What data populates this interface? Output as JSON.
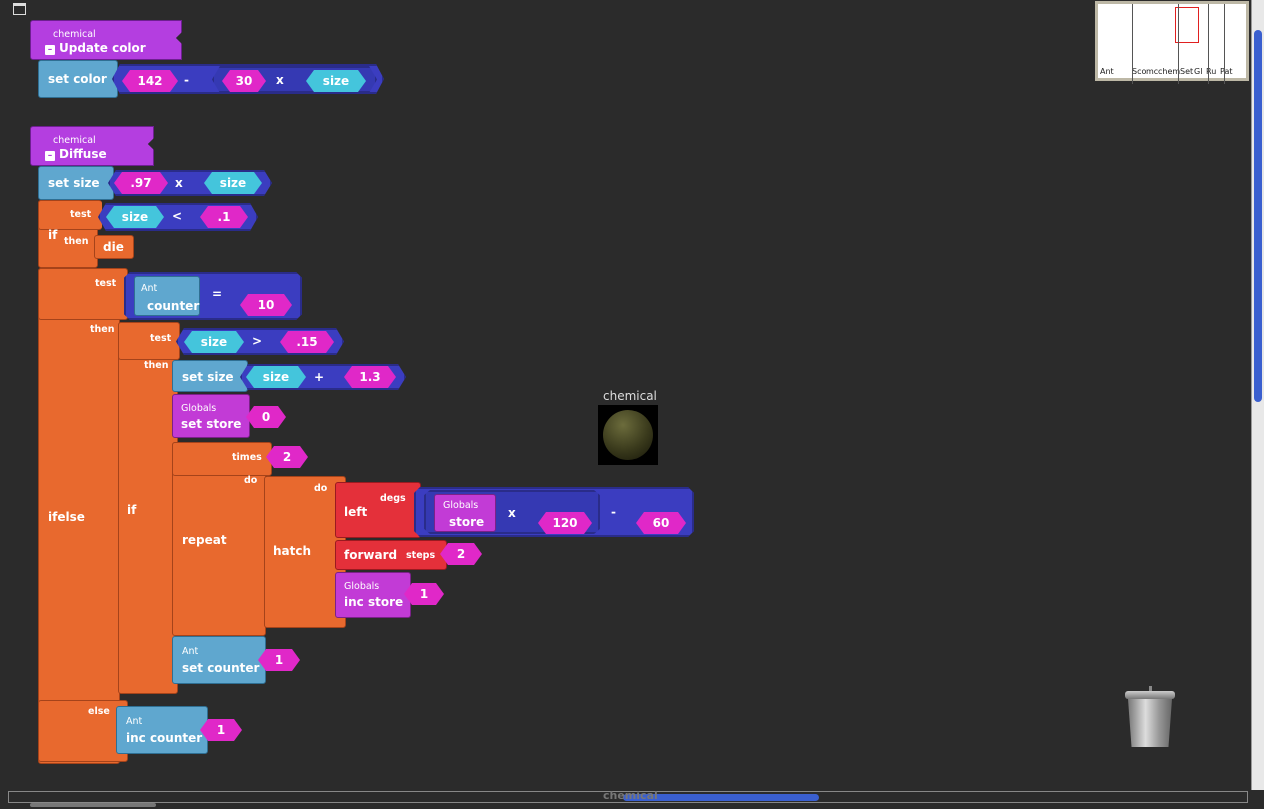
{
  "window": {
    "menu_icon": "window-menu-icon"
  },
  "minimap": {
    "labels": [
      "Ant",
      "Scope",
      "mc",
      "chem",
      "Set",
      "Gl",
      "Ru",
      "Pat"
    ]
  },
  "update_color": {
    "breed": "chemical",
    "name": "Update color",
    "set_label": "set color",
    "num1": "142",
    "op1": "-",
    "num2": "30",
    "op2": "x",
    "var": "size"
  },
  "diffuse": {
    "breed": "chemical",
    "name": "Diffuse",
    "set_size": {
      "label": "set size",
      "num": ".97",
      "op": "x",
      "var": "size"
    },
    "if1": {
      "label": "if",
      "test": "test",
      "then": "then",
      "var": "size",
      "op": "<",
      "num": ".1",
      "die": "die"
    },
    "ifelse": {
      "label": "ifelse",
      "test": "test",
      "then": "then",
      "else": "else",
      "cmp_breed": "Ant",
      "cmp_var": "counter",
      "cmp_op": "=",
      "cmp_num": "10",
      "if2": {
        "label": "if",
        "test": "test",
        "then": "then",
        "var": "size",
        "op": ">",
        "num": ".15"
      },
      "set_size2": {
        "label": "set size",
        "var": "size",
        "op": "+",
        "num": "1.3"
      },
      "set_store": {
        "breed": "Globals",
        "label": "set store",
        "num": "0"
      },
      "repeat": {
        "label": "repeat",
        "times": "times",
        "do": "do",
        "num": "2"
      },
      "hatch": {
        "label": "hatch",
        "do": "do"
      },
      "left": {
        "label": "left",
        "degs": "degs",
        "breed": "Globals",
        "var": "store",
        "op1": "x",
        "num1": "120",
        "op2": "-",
        "num2": "60"
      },
      "forward": {
        "label": "forward",
        "steps": "steps",
        "num": "2"
      },
      "inc_store": {
        "breed": "Globals",
        "label": "inc store",
        "num": "1"
      },
      "set_counter": {
        "breed": "Ant",
        "label": "set counter",
        "num": "1"
      },
      "inc_counter": {
        "breed": "Ant",
        "label": "inc counter",
        "num": "1"
      }
    }
  },
  "chemical_sprite": {
    "label": "chemical"
  },
  "bottom_label": "chemical",
  "trash": {
    "icon": "trash-can-icon"
  }
}
